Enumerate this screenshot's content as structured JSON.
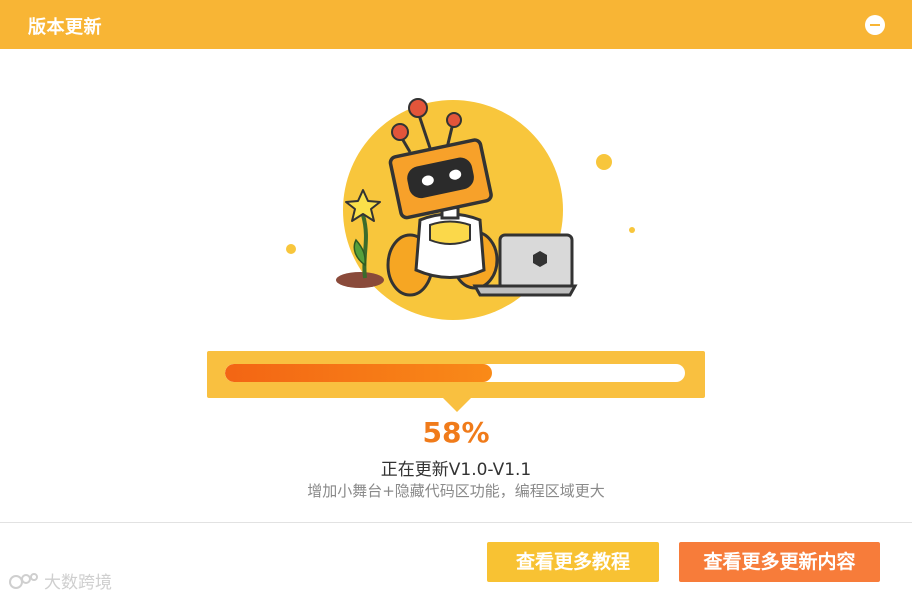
{
  "window": {
    "title": "版本更新"
  },
  "icons": {
    "minimize": "minimize-icon",
    "illustration": "robot-with-laptop-illustration",
    "watermark_logo": "watermark-logo-icon"
  },
  "progress": {
    "value": 0.58,
    "percent_text": "58%"
  },
  "status": {
    "text": "正在更新V1.0-V1.1",
    "description": "增加小舞台+隐藏代码区功能，编程区域更大"
  },
  "buttons": {
    "tutorials": "查看更多教程",
    "updates": "查看更多更新内容"
  },
  "watermark": {
    "text": "大数跨境"
  },
  "colors": {
    "titlebar": "#f8b535",
    "progress_panel": "#f9c040",
    "progress_fill_start": "#f36514",
    "progress_fill_end": "#f98a18",
    "percent": "#f07b1a",
    "button_tutorials": "#f8c233",
    "button_updates": "#f77c3a"
  }
}
